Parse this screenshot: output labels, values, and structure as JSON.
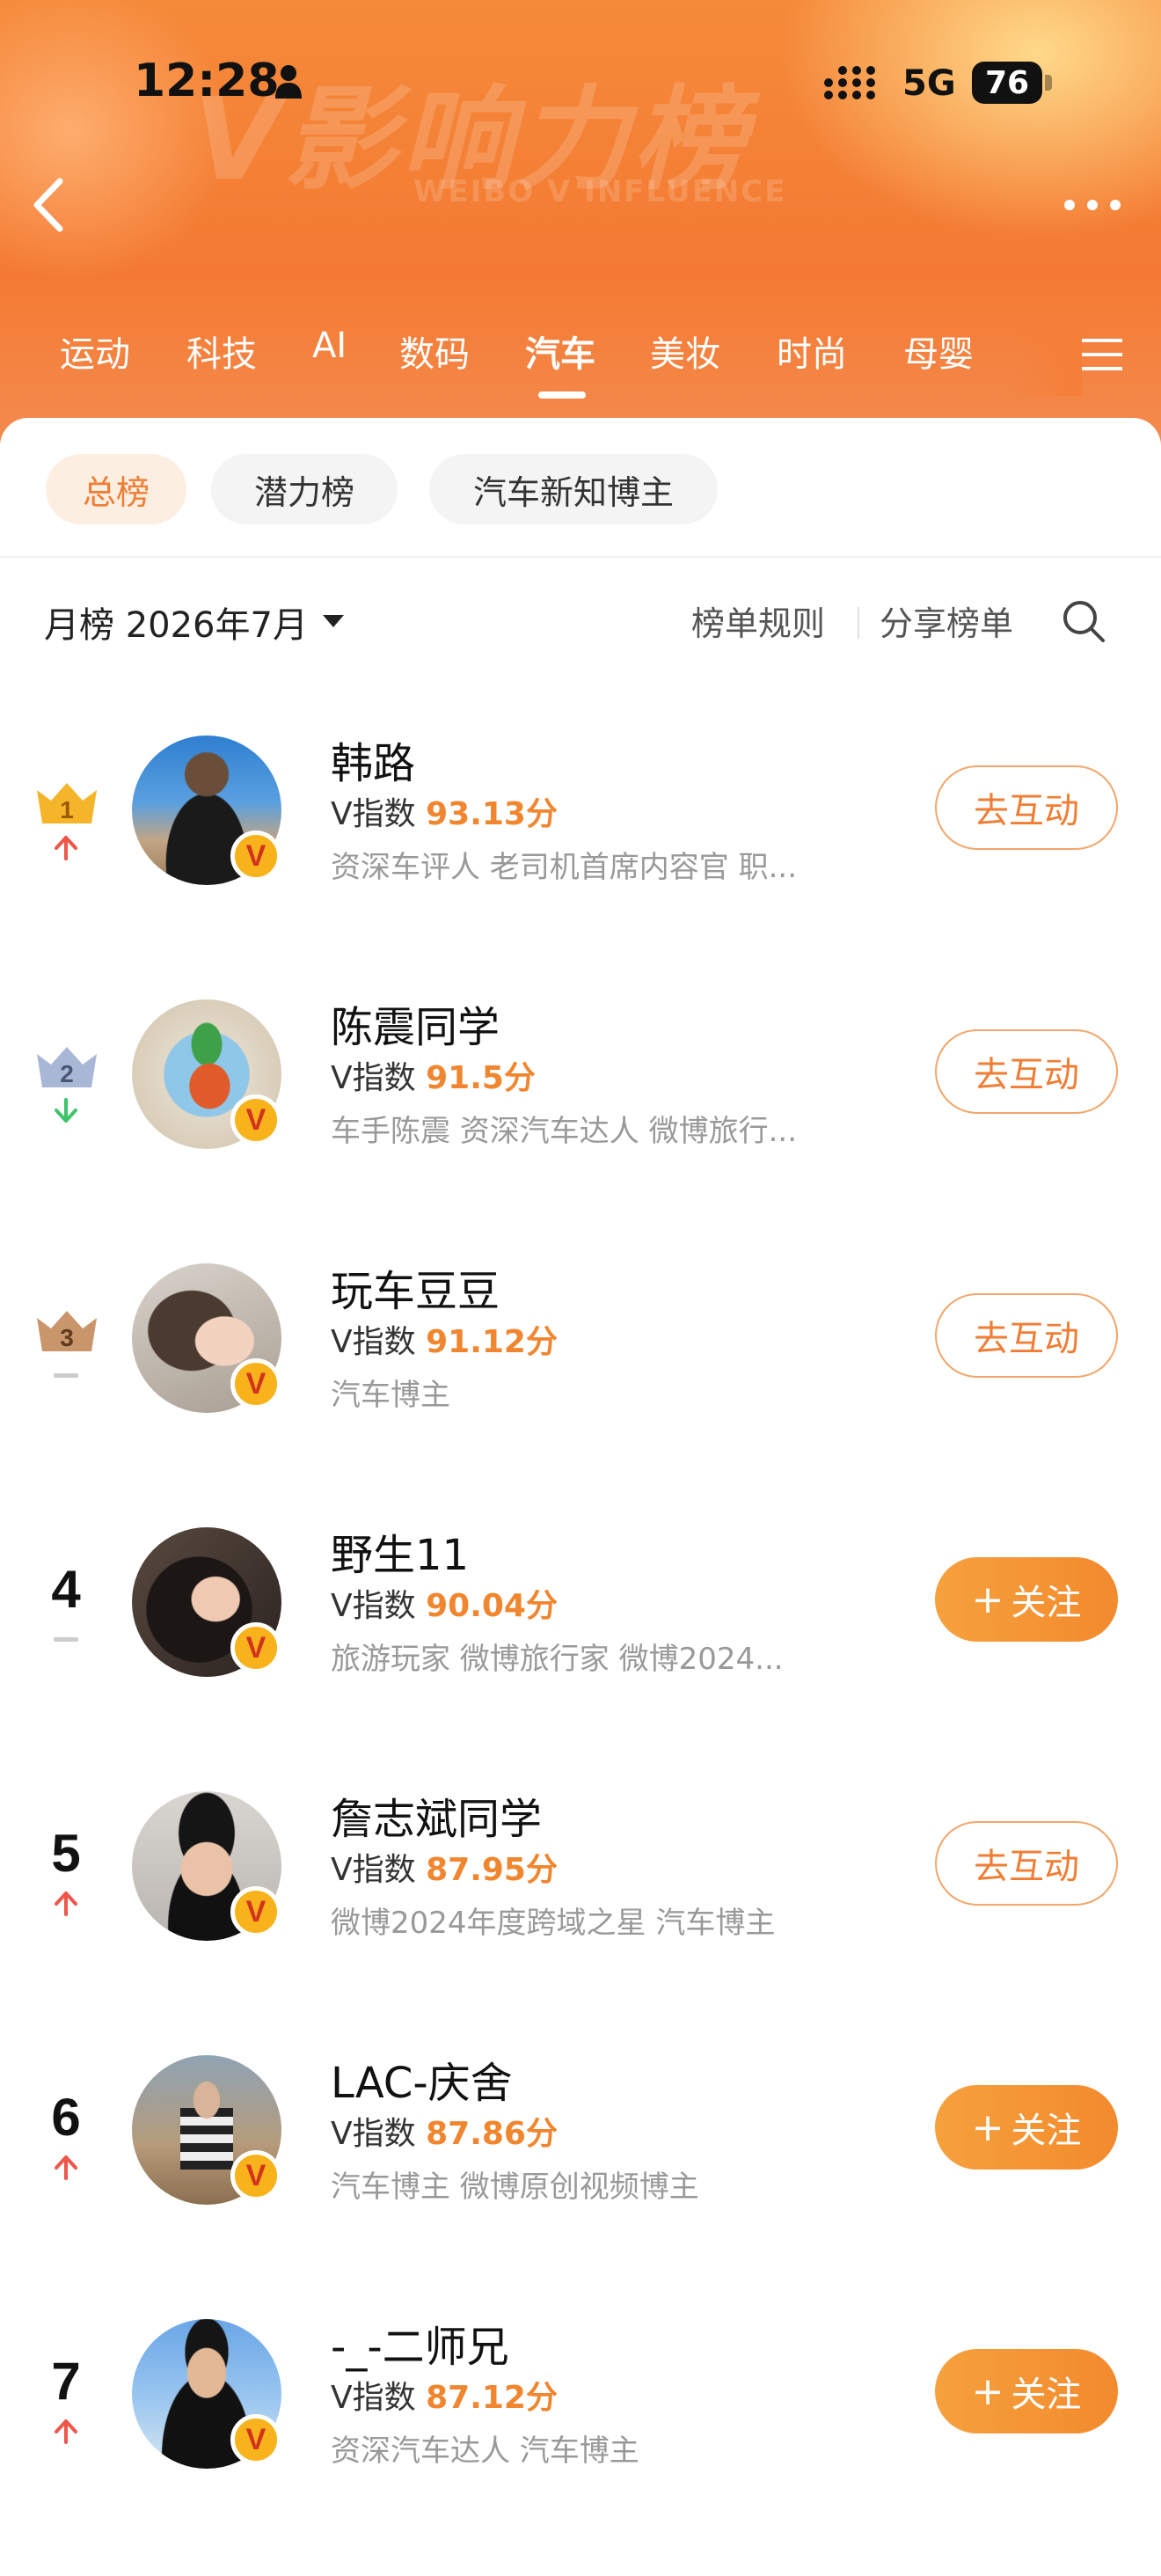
{
  "status_bar": {
    "time": "12:28",
    "network": "5G",
    "battery": "76"
  },
  "header": {
    "bg_title": "V影响力榜",
    "bg_subtitle": "WEIBO V INFLUENCE"
  },
  "categories": [
    "运动",
    "科技",
    "AI",
    "数码",
    "汽车",
    "美妆",
    "时尚",
    "母婴"
  ],
  "active_category": "汽车",
  "sub_tabs": [
    "总榜",
    "潜力榜",
    "汽车新知博主"
  ],
  "toolbar": {
    "month_label": "月榜 2026年7月",
    "rules_label": "榜单规则",
    "share_label": "分享榜单"
  },
  "ranking": [
    {
      "rank": "1",
      "trend": "up",
      "name": "韩路",
      "index_label": "V指数",
      "score": "93.13分",
      "desc": "资深车评人 老司机首席内容官 职...",
      "action": "去互动"
    },
    {
      "rank": "2",
      "trend": "down",
      "name": "陈震同学",
      "index_label": "V指数",
      "score": "91.5分",
      "desc": "车手陈震 资深汽车达人 微博旅行...",
      "action": "去互动"
    },
    {
      "rank": "3",
      "trend": "same",
      "name": "玩车豆豆",
      "index_label": "V指数",
      "score": "91.12分",
      "desc": "汽车博主",
      "action": "去互动"
    },
    {
      "rank": "4",
      "trend": "same",
      "name": "野生11",
      "index_label": "V指数",
      "score": "90.04分",
      "desc": "旅游玩家 微博旅行家 微博2024...",
      "action": "关注"
    },
    {
      "rank": "5",
      "trend": "up",
      "name": "詹志斌同学",
      "index_label": "V指数",
      "score": "87.95分",
      "desc": "微博2024年度跨域之星 汽车博主",
      "action": "去互动"
    },
    {
      "rank": "6",
      "trend": "up",
      "name": "LAC-庆舍",
      "index_label": "V指数",
      "score": "87.86分",
      "desc": "汽车博主 微博原创视频博主",
      "action": "关注"
    },
    {
      "rank": "7",
      "trend": "up",
      "name": "-_-二师兄",
      "index_label": "V指数",
      "score": "87.12分",
      "desc": "资深汽车达人 汽车博主",
      "action": "关注"
    }
  ],
  "icons": {
    "back": "chevron-left-icon",
    "more": "more-icon",
    "menu": "menu-icon",
    "search": "search-icon",
    "verified": "verified-v-badge"
  },
  "colors": {
    "accent": "#f07d33",
    "score": "#f0862f",
    "trend_up": "#f0554a",
    "trend_down": "#3fc46b",
    "trend_same": "#cccccc",
    "gold": "#f5b52a",
    "silver": "#a9b7d6",
    "bronze": "#c9966b"
  }
}
